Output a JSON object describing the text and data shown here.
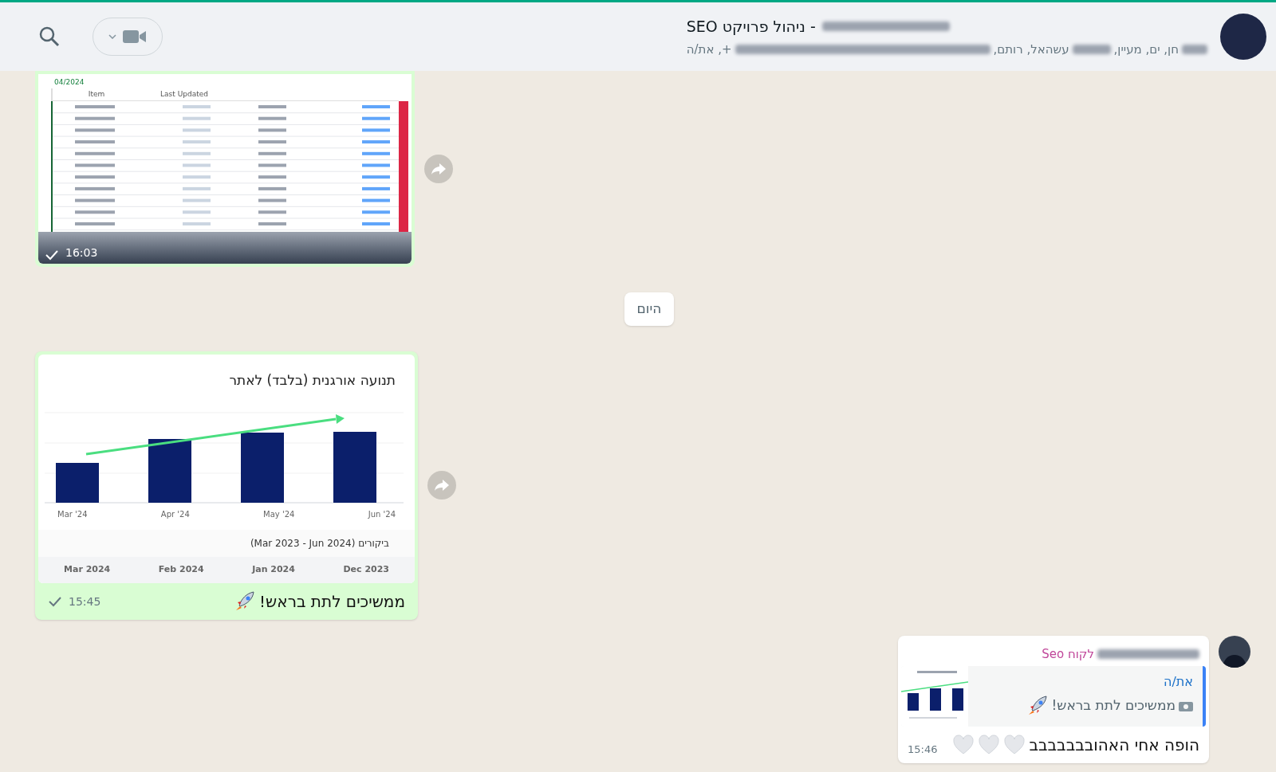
{
  "header": {
    "title": "- ניהול פרויקט SEO",
    "participants": [
      "חן, ים, מעיין,",
      "עשהאל, רותם,",
      "+, את/ה"
    ]
  },
  "messages": [
    {
      "kind": "table_image",
      "group": "04/2024",
      "columns": [
        "Last Updated",
        "Item"
      ],
      "time": "16:03"
    },
    {
      "kind": "date",
      "text": "היום"
    },
    {
      "kind": "chart_image",
      "title": "תנועה אורגנית (בלבד) לאתר",
      "x_labels": [
        "Jun '24",
        "May '24",
        "Apr '24",
        "Mar '24"
      ],
      "subtitle": "ביקורים (Mar 2023 - Jun 2024)",
      "months": [
        "Dec 2023",
        "Jan 2024",
        "Feb 2024",
        "Mar 2024"
      ],
      "caption": "ממשיכים לתת בראש!",
      "time": "15:45"
    },
    {
      "kind": "reply",
      "sender": "לקוח Seo",
      "quote_author": "את/ה",
      "quote_text": "ממשיכים לתת בראש!",
      "text": "הופה אחי האהובבבבבבב",
      "time": "15:46"
    }
  ]
}
